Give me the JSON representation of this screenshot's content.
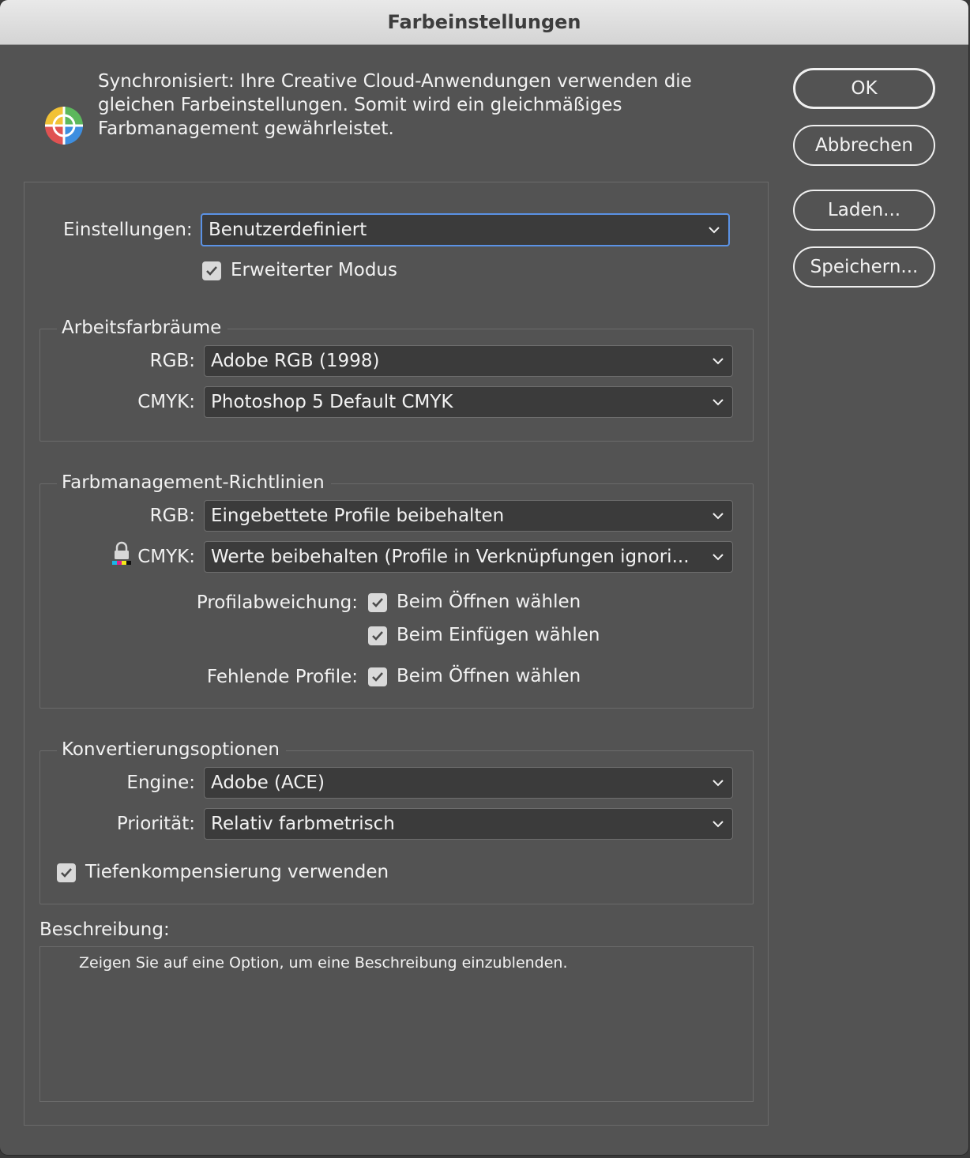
{
  "window": {
    "title": "Farbeinstellungen"
  },
  "sync": {
    "message": "Synchronisiert: Ihre Creative Cloud-Anwendungen verwenden die\ngleichen Farbeinstellungen. Somit wird ein gleichmäßiges\nFarbmanagement gewährleistet."
  },
  "buttons": {
    "ok": "OK",
    "cancel": "Abbrechen",
    "load": "Laden...",
    "save": "Speichern..."
  },
  "settings": {
    "label": "Einstellungen:",
    "value": "Benutzerdefiniert",
    "advanced_mode": {
      "label": "Erweiterter Modus",
      "checked": true
    }
  },
  "working_spaces": {
    "title": "Arbeitsfarbräume",
    "rgb_label": "RGB:",
    "rgb_value": "Adobe RGB (1998)",
    "cmyk_label": "CMYK:",
    "cmyk_value": "Photoshop 5 Default CMYK"
  },
  "policies": {
    "title": "Farbmanagement-Richtlinien",
    "rgb_label": "RGB:",
    "rgb_value": "Eingebettete Profile beibehalten",
    "cmyk_label": "CMYK:",
    "cmyk_value": "Werte beibehalten (Profile in Verknüpfungen ignori...",
    "profile_mismatch_label": "Profilabweichung:",
    "ask_on_open_label": "Beim Öffnen wählen",
    "ask_on_paste_label": "Beim Einfügen wählen",
    "missing_profiles_label": "Fehlende Profile:",
    "missing_ask_on_open_label": "Beim Öffnen wählen"
  },
  "conversion": {
    "title": "Konvertierungsoptionen",
    "engine_label": "Engine:",
    "engine_value": "Adobe (ACE)",
    "intent_label": "Priorität:",
    "intent_value": "Relativ farbmetrisch",
    "black_point_label": "Tiefenkompensierung verwenden"
  },
  "description": {
    "label": "Beschreibung:",
    "text": "Zeigen Sie auf eine Option, um eine Beschreibung einzublenden."
  },
  "colors": {
    "background": "#535353",
    "focus": "#5b92e5",
    "field": "#3b3b3b"
  },
  "icons": {
    "sync": "creative-cloud-color-sync-icon",
    "chevron": "chevron-down-icon",
    "check": "checkmark-icon",
    "lock": "lock-icon"
  }
}
